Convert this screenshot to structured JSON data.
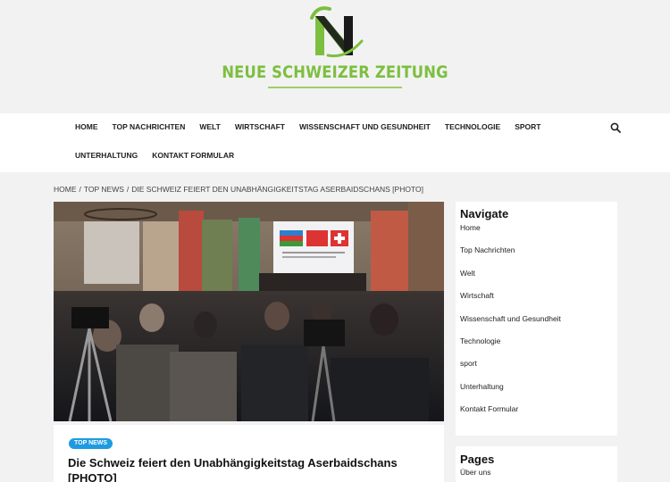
{
  "site": {
    "title": "NEUE SCHWEIZER ZEITUNG",
    "logo_letter": "N",
    "brand_green": "#7cbf3f",
    "brand_dark": "#1a1a1a"
  },
  "nav": {
    "row1": [
      "HOME",
      "TOP NACHRICHTEN",
      "WELT",
      "WIRTSCHAFT",
      "WISSENSCHAFT UND GESUNDHEIT",
      "TECHNOLOGIE",
      "SPORT"
    ],
    "row2": [
      "UNTERHALTUNG",
      "KONTAKT FORMULAR"
    ],
    "search_icon": "search-icon"
  },
  "breadcrumb": [
    "HOME",
    "TOP NEWS",
    "DIE SCHWEIZ FEIERT DEN UNABHÄNGIGKEITSTAG ASERBAIDSCHANS [PHOTO]"
  ],
  "article": {
    "badge": "TOP NEWS",
    "badge_color": "#1e9be0",
    "title": "Die Schweiz feiert den Unabhängigkeitstag Aserbaidschans [PHOTO]"
  },
  "sidebar": {
    "navigate": {
      "title": "Navigate",
      "items": [
        "Home",
        "Top Nachrichten",
        "Welt",
        "Wirtschaft",
        "Wissenschaft und Gesundheit",
        "Technologie",
        "sport",
        "Unterhaltung",
        "Kontakt Formular"
      ]
    },
    "pages": {
      "title": "Pages",
      "items": [
        "Über uns"
      ]
    }
  }
}
